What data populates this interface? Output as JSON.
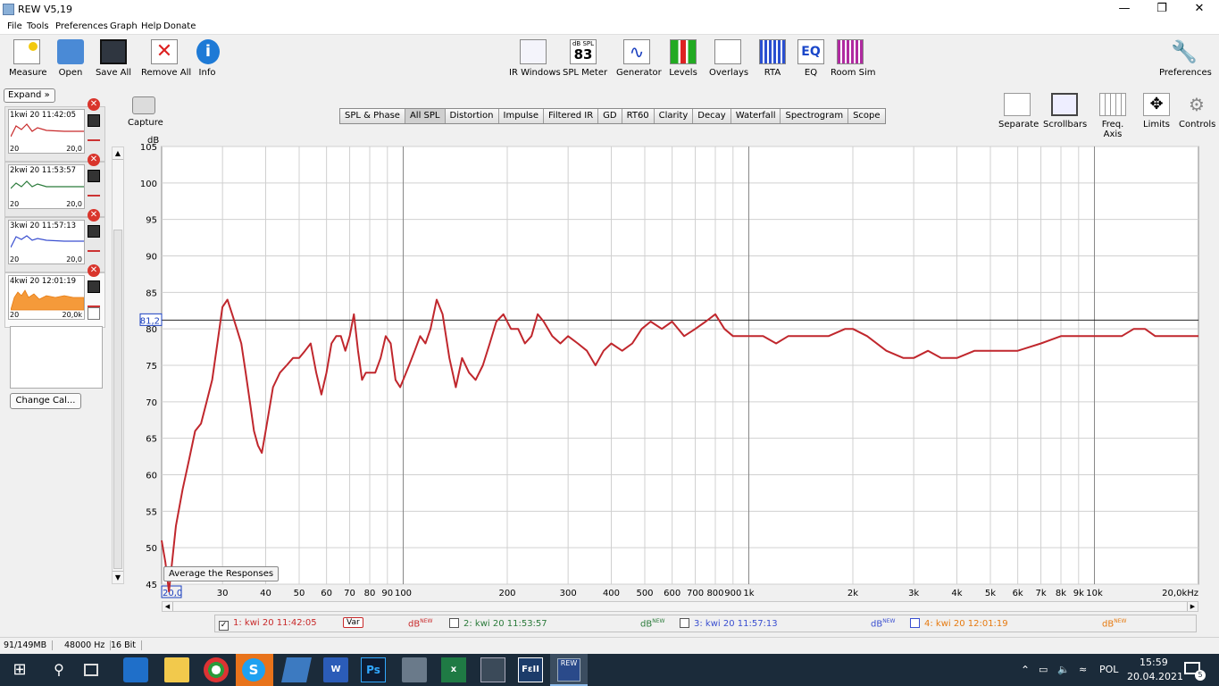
{
  "window": {
    "title": "REW V5,19"
  },
  "menu": [
    "File",
    "Tools",
    "Preferences",
    "Graph",
    "Help",
    "Donate"
  ],
  "toolbar_left": [
    "Measure",
    "Open",
    "Save All",
    "Remove All",
    "Info"
  ],
  "toolbar_center": [
    "IR Windows",
    "SPL Meter",
    "Generator",
    "Levels",
    "Overlays",
    "RTA",
    "EQ",
    "Room Sim"
  ],
  "spl_meter": {
    "top": "dB SPL",
    "value": "83"
  },
  "toolbar_right": {
    "preferences": "Preferences"
  },
  "panel": {
    "expand": "Expand",
    "change_cal": "Change Cal...",
    "capture": "Capture",
    "measurements": [
      {
        "label": "kwi 20 11:42:05",
        "num": "1",
        "min": "20",
        "max": "20,0",
        "color": "#c8292a"
      },
      {
        "label": "kwi 20 11:53:57",
        "num": "2",
        "min": "20",
        "max": "20,0",
        "color": "#2a7a3a"
      },
      {
        "label": "kwi 20 11:57:13",
        "num": "3",
        "min": "20",
        "max": "20,0",
        "color": "#3a4fd0"
      },
      {
        "label": "kwi 20 12:01:19",
        "num": "4",
        "min": "20",
        "max": "20,0k",
        "color": "#e67a10"
      }
    ]
  },
  "tabs": [
    "SPL & Phase",
    "All SPL",
    "Distortion",
    "Impulse",
    "Filtered IR",
    "GD",
    "RT60",
    "Clarity",
    "Decay",
    "Waterfall",
    "Spectrogram",
    "Scope"
  ],
  "active_tab": "All SPL",
  "graph_controls": [
    "Separate",
    "Scrollbars",
    "Freq. Axis",
    "Limits",
    "Controls"
  ],
  "plot": {
    "average_button": "Average the Responses",
    "marker_value": "81,2",
    "start_freq": "20,0",
    "end_freq": "20,0kHz",
    "unit_label": "dB"
  },
  "chart_data": {
    "type": "line",
    "xscale": "log",
    "xlim": [
      20,
      20000
    ],
    "ylim": [
      45,
      105
    ],
    "ylabel": "dB",
    "yticks": [
      45,
      50,
      55,
      60,
      65,
      70,
      75,
      80,
      85,
      90,
      95,
      100,
      105
    ],
    "xticks": [
      {
        "v": 30,
        "l": "30"
      },
      {
        "v": 40,
        "l": "40"
      },
      {
        "v": 50,
        "l": "50"
      },
      {
        "v": 60,
        "l": "60"
      },
      {
        "v": 70,
        "l": "70"
      },
      {
        "v": 80,
        "l": "80"
      },
      {
        "v": 90,
        "l": "90"
      },
      {
        "v": 100,
        "l": "100"
      },
      {
        "v": 200,
        "l": "200"
      },
      {
        "v": 300,
        "l": "300"
      },
      {
        "v": 400,
        "l": "400"
      },
      {
        "v": 500,
        "l": "500"
      },
      {
        "v": 600,
        "l": "600"
      },
      {
        "v": 700,
        "l": "700"
      },
      {
        "v": 800,
        "l": "800"
      },
      {
        "v": 900,
        "l": "900"
      },
      {
        "v": 1000,
        "l": "1k"
      },
      {
        "v": 2000,
        "l": "2k"
      },
      {
        "v": 3000,
        "l": "3k"
      },
      {
        "v": 4000,
        "l": "4k"
      },
      {
        "v": 5000,
        "l": "5k"
      },
      {
        "v": 6000,
        "l": "6k"
      },
      {
        "v": 7000,
        "l": "7k"
      },
      {
        "v": 8000,
        "l": "8k"
      },
      {
        "v": 9000,
        "l": "9k"
      },
      {
        "v": 10000,
        "l": "10k"
      }
    ],
    "hline": 81.2,
    "series": [
      {
        "color": "#c0272d",
        "x": [
          20,
          20.5,
          21,
          22,
          23,
          24,
          25,
          26,
          27,
          28,
          29,
          30,
          31,
          32,
          33,
          34,
          35,
          36,
          37,
          38,
          39,
          40,
          42,
          44,
          46,
          48,
          50,
          52,
          54,
          56,
          58,
          60,
          62,
          64,
          66,
          68,
          70,
          72,
          74,
          76,
          78,
          80,
          83,
          86,
          89,
          92,
          95,
          98,
          100,
          104,
          108,
          112,
          116,
          120,
          125,
          130,
          136,
          142,
          148,
          155,
          162,
          170,
          178,
          186,
          195,
          205,
          215,
          225,
          235,
          245,
          255,
          270,
          285,
          300,
          320,
          340,
          360,
          380,
          400,
          430,
          460,
          490,
          520,
          560,
          600,
          650,
          700,
          750,
          800,
          850,
          900,
          950,
          1000,
          1100,
          1200,
          1300,
          1400,
          1500,
          1700,
          1900,
          2000,
          2200,
          2500,
          2800,
          3000,
          3300,
          3600,
          4000,
          4500,
          5000,
          6000,
          7000,
          8000,
          9000,
          10000,
          11000,
          12000,
          13000,
          14000,
          15000,
          16000,
          18000,
          20000
        ],
        "y": [
          51,
          48,
          44,
          53,
          58,
          62,
          66,
          67,
          70,
          73,
          78,
          83,
          84,
          82,
          80,
          78,
          74,
          70,
          66,
          64,
          63,
          66,
          72,
          74,
          75,
          76,
          76,
          77,
          78,
          74,
          71,
          74,
          78,
          79,
          79,
          77,
          79,
          82,
          77,
          73,
          74,
          74,
          74,
          76,
          79,
          78,
          73,
          72,
          73,
          75,
          77,
          79,
          78,
          80,
          84,
          82,
          76,
          72,
          76,
          74,
          73,
          75,
          78,
          81,
          82,
          80,
          80,
          78,
          79,
          82,
          81,
          79,
          78,
          79,
          78,
          77,
          75,
          77,
          78,
          77,
          78,
          80,
          81,
          80,
          81,
          79,
          80,
          81,
          82,
          80,
          79,
          79,
          79,
          79,
          78,
          79,
          79,
          79,
          79,
          80,
          80,
          79,
          77,
          76,
          76,
          77,
          76,
          76,
          77,
          77,
          77,
          78,
          79,
          79,
          79,
          79,
          79,
          80,
          80,
          79,
          79,
          79,
          79
        ]
      }
    ]
  },
  "legend": [
    {
      "label": "1: kwi 20 11:42:05",
      "color": "#c8292a",
      "checked": "✓",
      "var": "Var",
      "db": "dB",
      "sup": "NEW"
    },
    {
      "label": "2: kwi 20 11:53:57",
      "color": "#2a7a3a",
      "checked": "",
      "db": "dB",
      "sup": "NEW"
    },
    {
      "label": "3: kwi 20 11:57:13",
      "color": "#3a4fd0",
      "checked": "",
      "db": "dB",
      "sup": "NEW"
    },
    {
      "label": "4: kwi 20 12:01:19",
      "color": "#e67a10",
      "checked": "",
      "db": "dB",
      "sup": "NEW"
    }
  ],
  "status": [
    "91/149MB",
    "48000 Hz",
    "16 Bit"
  ],
  "taskbar": {
    "lang": "POL",
    "time": "15:59",
    "date": "20.04.2021",
    "badge": "5"
  }
}
